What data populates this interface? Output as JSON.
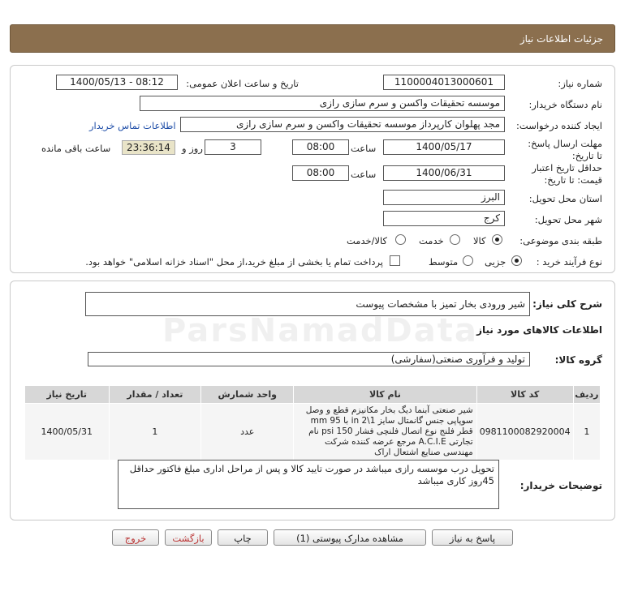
{
  "header": {
    "title": "جزئیات اطلاعات نیاز"
  },
  "watermark": "ParsNamadData",
  "form": {
    "need_number_label": "شماره نیاز:",
    "need_number": "1100004013000601",
    "announce_label": "تاریخ و ساعت اعلان عمومی:",
    "announce_value": "1400/05/13 - 08:12",
    "buyer_org_label": "نام دستگاه خریدار:",
    "buyer_org": "موسسه تحقیقات واکسن و سرم سازی رازی",
    "creator_label": "ایجاد کننده درخواست:",
    "creator": "مجد پهلوان  کارپرداز موسسه تحقیقات واکسن و سرم سازی رازی",
    "contact_link": "اطلاعات تماس خریدار",
    "deadline_label": "مهلت ارسال پاسخ: تا تاریخ:",
    "deadline_date": "1400/05/17",
    "time_label": "ساعت",
    "deadline_time": "08:00",
    "days": "3",
    "days_label": "روز و",
    "remaining_time": "23:36:14",
    "remaining_label": "ساعت باقی مانده",
    "validity_label": "حداقل تاریخ اعتبار قیمت: تا تاریخ:",
    "validity_date": "1400/06/31",
    "validity_time_label": "ساعت",
    "validity_time": "08:00",
    "province_label": "استان محل تحویل:",
    "province": "البرز",
    "city_label": "شهر محل تحویل:",
    "city": "کرج",
    "category_label": "طبقه بندی موضوعی:",
    "category_options": [
      "کالا",
      "خدمت",
      "کالا/خدمت"
    ],
    "process_label": "نوع فرآیند خرید :",
    "process_options": [
      "جزیی",
      "متوسط"
    ],
    "payment_note": "پرداخت تمام یا بخشی از مبلغ خرید،از محل \"اسناد خزانه اسلامی\" خواهد بود."
  },
  "details": {
    "summary_label": "شرح کلی نیاز:",
    "summary": "شیر ورودی بخار تمیز با مشخصات پیوست",
    "goods_info_title": "اطلاعات کالاهای مورد نیاز",
    "goods_group_label": "گروه کالا:",
    "goods_group": "تولید و فرآوری صنعتی(سفارشی)",
    "table": {
      "headers": [
        "ردیف",
        "کد کالا",
        "نام کالا",
        "واحد شمارش",
        "تعداد / مقدار",
        "تاریخ نیاز"
      ],
      "rows": [
        {
          "row": "1",
          "code": "0981100082920004",
          "name": "شیر صنعتی آبنما دیگ بخار مکانیزم قطع و وصل سوپاپی جنس گانمتال سایز in 2\\1 با mm 95 قطر فلنج نوع اتصال فلنچی فشار psi 150 نام تجارتی A.C.I.E مرجع عرضه کننده شرکت مهندسی صنایع اشتعال اراک",
          "unit": "عدد",
          "qty": "1",
          "date": "1400/05/31"
        }
      ]
    },
    "buyer_notes_label": "توضیحات خریدار:",
    "buyer_notes": "تحویل درب موسسه رازی میباشد در صورت تایید کالا و پس از مراحل اداری مبلغ فاکتور حداقل 45روز کاری میباشد"
  },
  "buttons": {
    "reply": "پاسخ به نیاز",
    "attachments": "مشاهده مدارک پیوستی (1)",
    "print": "چاپ",
    "back": "بازگشت",
    "exit": "خروج"
  }
}
